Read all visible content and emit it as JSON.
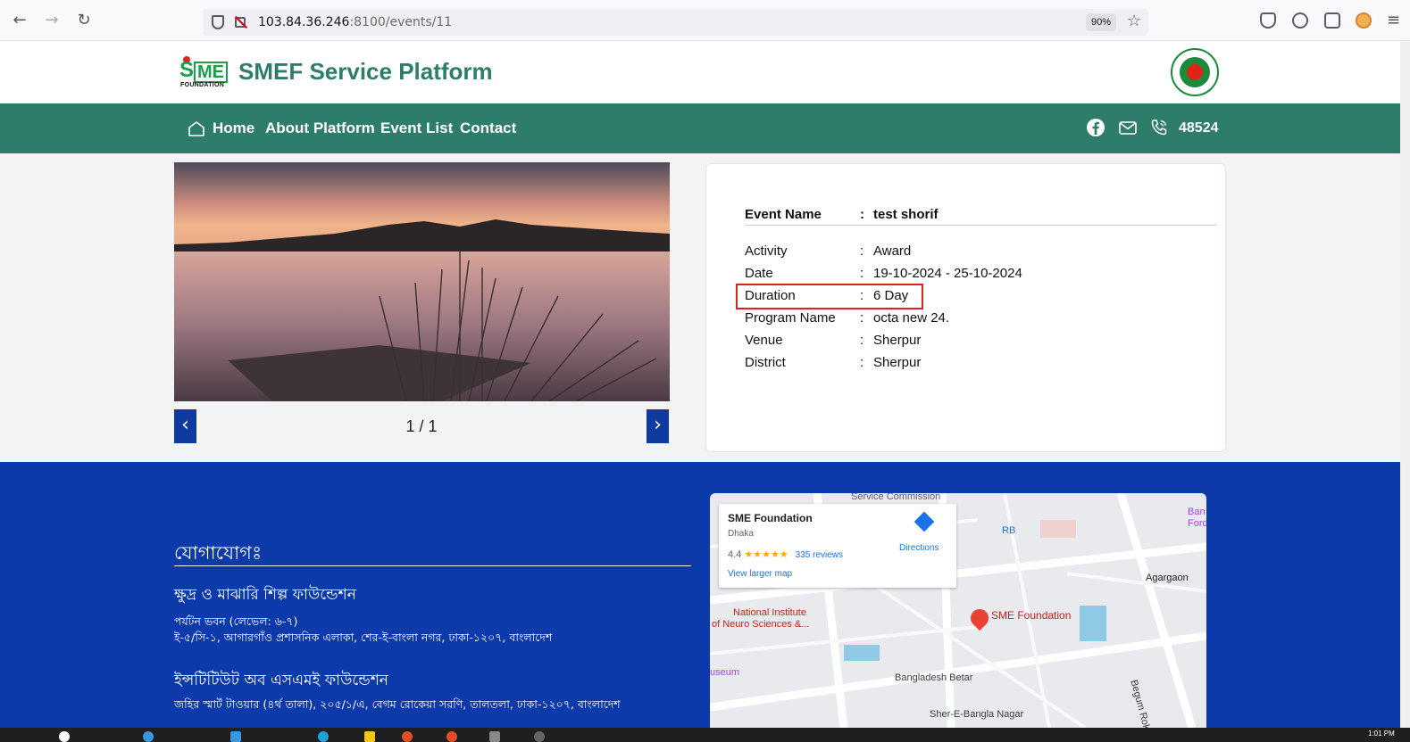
{
  "browser": {
    "url_host": "103.84.36.246",
    "url_rest": ":8100/events/11",
    "zoom": "90%"
  },
  "header": {
    "logo_letters_s": "S",
    "logo_letters_me": "ME",
    "logo_foundation": "FOUNDATION",
    "title": "SMEF Service Platform"
  },
  "nav": {
    "items": [
      "Home",
      "About Platform",
      "Event List",
      "Contact"
    ],
    "phone": "48524"
  },
  "carousel": {
    "counter": "1 / 1",
    "prev": "‹",
    "next": "›"
  },
  "event": {
    "rows": [
      {
        "label": "Event Name",
        "value": "test shorif"
      },
      {
        "label": "Activity",
        "value": "Award"
      },
      {
        "label": "Date",
        "value": "19-10-2024 - 25-10-2024"
      },
      {
        "label": "Duration",
        "value": "6 Day"
      },
      {
        "label": "Program Name",
        "value": "octa new 24."
      },
      {
        "label": "Venue",
        "value": "Sherpur"
      },
      {
        "label": "District",
        "value": "Sherpur"
      }
    ],
    "colon": ":"
  },
  "footer": {
    "contact_heading": "যোগাযোগঃ",
    "org1_title": "ক্ষুদ্র ও মাঝারি শিল্প ফাউন্ডেশন",
    "org1_line1": "পর্যটন ভবন (লেভেল: ৬-৭)",
    "org1_line2": "ই-৫/সি-১, আগারগাঁও প্রশাসনিক এলাকা, শের-ই-বাংলা নগর, ঢাকা-১২০৭, বাংলাদেশ",
    "org2_title": "ইন্সটিটিউট অব এসএমই ফাউন্ডেশন",
    "org2_line1": "জহির স্মার্ট টাওয়ার (৪র্থ তালা), ২০৫/১/এ, বেগম রোকেয়া সরণি, তালতলা, ঢাকা-১২০৭, বাংলাদেশ"
  },
  "map": {
    "place": "SME Foundation",
    "city": "Dhaka",
    "rating": "4.4",
    "stars": "★★★★★",
    "reviews": "335 reviews",
    "larger": "View larger map",
    "directions": "Directions",
    "labels": {
      "service_commission": "Service Commission",
      "rb": "RB",
      "agargaon": "Agargaon",
      "neuro1": "National Institute",
      "neuro2": "of Neuro Sciences &...",
      "pin_label": "SME Foundation",
      "betar": "Bangladesh Betar",
      "museum": "useum",
      "sher1": "Sher-E-Bangla Nagar",
      "begum": "Begum Rokeya",
      "ban": "Ban",
      "ford": "Ford"
    }
  },
  "taskbar": {
    "clock": "1:01 PM"
  },
  "colors": {
    "brand_green": "#2e7d6b",
    "footer_blue": "#0d3aab",
    "carousel_btn": "#0d3a9f",
    "highlight_red": "#e02020"
  }
}
